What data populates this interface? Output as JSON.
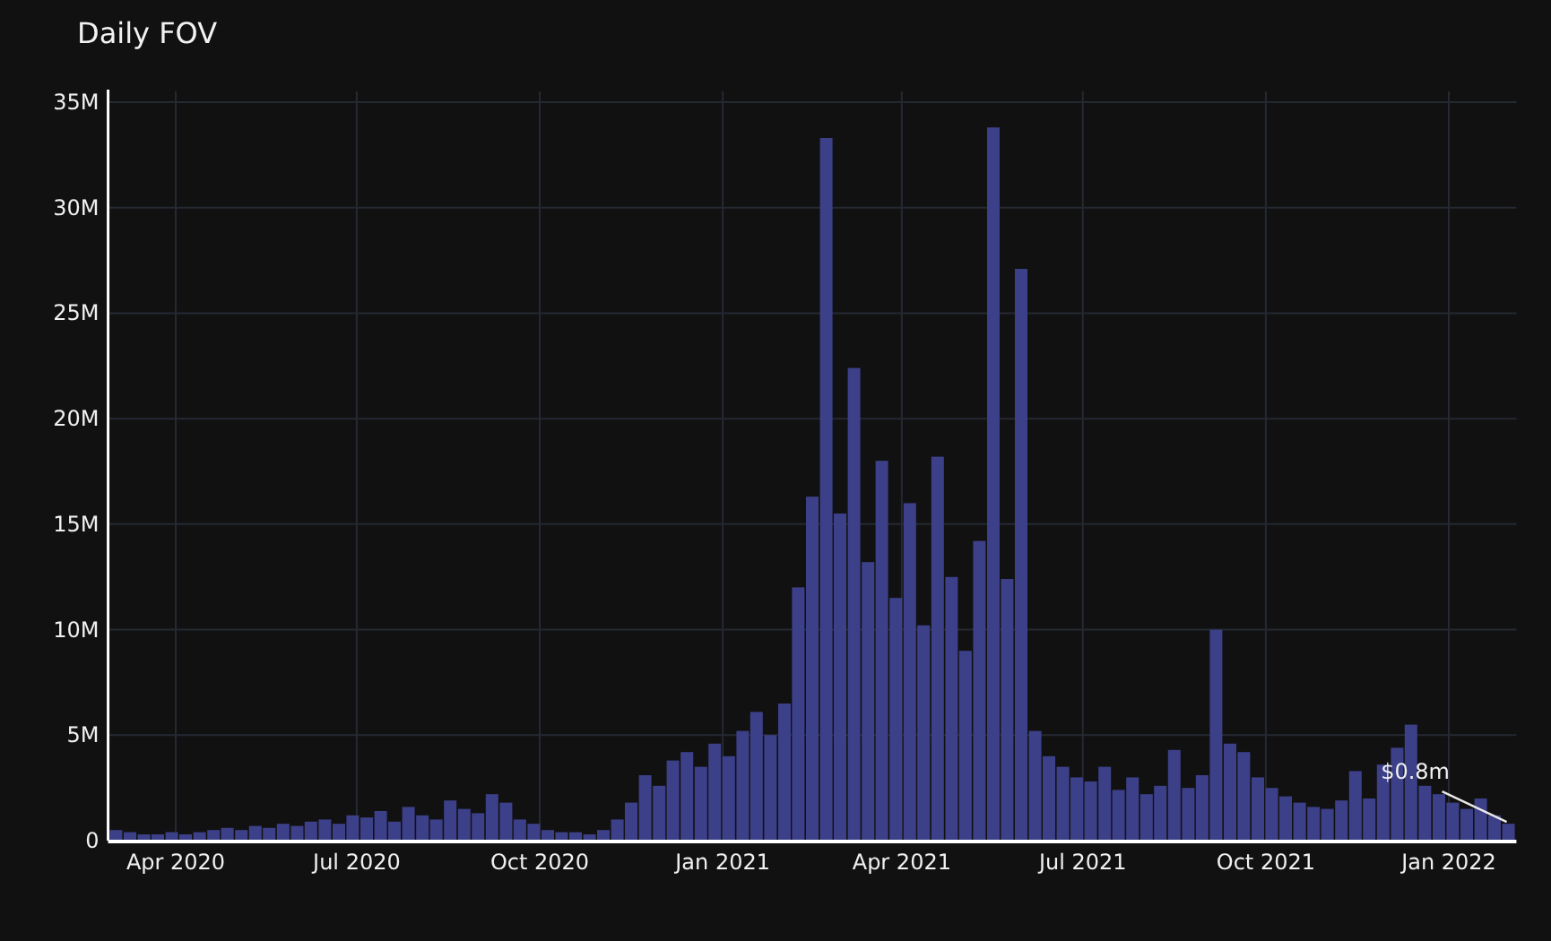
{
  "title": "Daily FOV",
  "chart_data": {
    "type": "bar",
    "x": [
      "2020-03-02",
      "2020-03-09",
      "2020-03-16",
      "2020-03-23",
      "2020-03-30",
      "2020-04-06",
      "2020-04-13",
      "2020-04-20",
      "2020-04-27",
      "2020-05-04",
      "2020-05-11",
      "2020-05-18",
      "2020-05-25",
      "2020-06-01",
      "2020-06-08",
      "2020-06-15",
      "2020-06-22",
      "2020-06-29",
      "2020-07-06",
      "2020-07-13",
      "2020-07-20",
      "2020-07-27",
      "2020-08-03",
      "2020-08-10",
      "2020-08-17",
      "2020-08-24",
      "2020-08-31",
      "2020-09-07",
      "2020-09-14",
      "2020-09-21",
      "2020-09-28",
      "2020-10-05",
      "2020-10-12",
      "2020-10-19",
      "2020-10-26",
      "2020-11-02",
      "2020-11-09",
      "2020-11-16",
      "2020-11-23",
      "2020-11-30",
      "2020-12-07",
      "2020-12-14",
      "2020-12-21",
      "2020-12-28",
      "2021-01-04",
      "2021-01-11",
      "2021-01-18",
      "2021-01-25",
      "2021-02-01",
      "2021-02-08",
      "2021-02-15",
      "2021-02-22",
      "2021-03-01",
      "2021-03-08",
      "2021-03-15",
      "2021-03-22",
      "2021-03-29",
      "2021-04-05",
      "2021-04-12",
      "2021-04-19",
      "2021-04-26",
      "2021-05-03",
      "2021-05-10",
      "2021-05-17",
      "2021-05-24",
      "2021-05-31",
      "2021-06-07",
      "2021-06-14",
      "2021-06-21",
      "2021-06-28",
      "2021-07-05",
      "2021-07-12",
      "2021-07-19",
      "2021-07-26",
      "2021-08-02",
      "2021-08-09",
      "2021-08-16",
      "2021-08-23",
      "2021-08-30",
      "2021-09-06",
      "2021-09-13",
      "2021-09-20",
      "2021-09-27",
      "2021-10-04",
      "2021-10-11",
      "2021-10-18",
      "2021-10-25",
      "2021-11-01",
      "2021-11-08",
      "2021-11-15",
      "2021-11-22",
      "2021-11-29",
      "2021-12-06",
      "2021-12-13",
      "2021-12-20",
      "2021-12-27",
      "2022-01-03",
      "2022-01-10",
      "2022-01-17",
      "2022-01-24",
      "2022-01-31"
    ],
    "series": [
      {
        "color": "#3c4088",
        "values": [
          0.5,
          0.4,
          0.3,
          0.3,
          0.4,
          0.3,
          0.4,
          0.5,
          0.6,
          0.5,
          0.7,
          0.6,
          0.8,
          0.7,
          0.9,
          1.0,
          0.8,
          1.2,
          1.1,
          1.4,
          0.9,
          1.6,
          1.2,
          1.0,
          1.9,
          1.5,
          1.3,
          2.2,
          1.8,
          1.0,
          0.8,
          0.5,
          0.4,
          0.4,
          0.3,
          0.5,
          1.0,
          1.8,
          3.1,
          2.6,
          3.8,
          4.2,
          3.5,
          4.6,
          4.0,
          5.2,
          6.1,
          5.0,
          6.5,
          12.0,
          16.3,
          33.3,
          15.5,
          22.4,
          13.2,
          18.0,
          11.5,
          16.0,
          10.2,
          18.2,
          12.5,
          9.0,
          14.2,
          33.8,
          12.4,
          27.1,
          5.2,
          4.0,
          3.5,
          3.0,
          2.8,
          3.5,
          2.4,
          3.0,
          2.2,
          2.6,
          4.3,
          2.5,
          3.1,
          10.0,
          4.6,
          4.2,
          3.0,
          2.5,
          2.1,
          1.8,
          1.6,
          1.5,
          1.9,
          3.3,
          2.0,
          3.6,
          4.4,
          5.5,
          2.6,
          2.2,
          1.8,
          1.5,
          2.0,
          1.2,
          0.8
        ]
      }
    ],
    "xlim": [
      "2020-02-27",
      "2022-02-04"
    ],
    "ylim": [
      0,
      35
    ],
    "grid": true,
    "yticks": [
      {
        "value": 0,
        "label": "0"
      },
      {
        "value": 5,
        "label": "5M"
      },
      {
        "value": 10,
        "label": "10M"
      },
      {
        "value": 15,
        "label": "15M"
      },
      {
        "value": 20,
        "label": "20M"
      },
      {
        "value": 25,
        "label": "25M"
      },
      {
        "value": 30,
        "label": "30M"
      },
      {
        "value": 35,
        "label": "35M"
      }
    ],
    "xticks": [
      {
        "value": "2020-04-01",
        "label": "Apr 2020"
      },
      {
        "value": "2020-07-01",
        "label": "Jul 2020"
      },
      {
        "value": "2020-10-01",
        "label": "Oct 2020"
      },
      {
        "value": "2021-01-01",
        "label": "Jan 2021"
      },
      {
        "value": "2021-04-01",
        "label": "Apr 2021"
      },
      {
        "value": "2021-07-01",
        "label": "Jul 2021"
      },
      {
        "value": "2021-10-01",
        "label": "Oct 2021"
      },
      {
        "value": "2022-01-01",
        "label": "Jan 2022"
      }
    ],
    "annotations": [
      "$0.8m"
    ]
  }
}
